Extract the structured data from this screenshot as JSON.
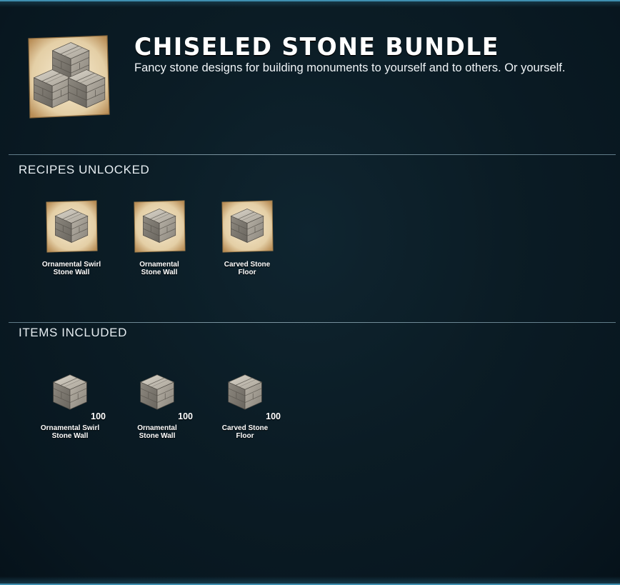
{
  "bundle": {
    "title": "Chiseled Stone Bundle",
    "description": "Fancy stone designs for building monuments to yourself and to others. Or yourself.",
    "icon": "stone-blocks-icon"
  },
  "recipes_section": {
    "heading": "RECIPES UNLOCKED",
    "items": [
      {
        "line1": "Ornamental Swirl",
        "line2": "Stone Wall",
        "icon": "ornamental-swirl-stone-wall-icon"
      },
      {
        "line1": "Ornamental",
        "line2": "Stone Wall",
        "icon": "ornamental-stone-wall-icon"
      },
      {
        "line1": "Carved Stone",
        "line2": "Floor",
        "icon": "carved-stone-floor-icon"
      }
    ]
  },
  "items_section": {
    "heading": "ITEMS INCLUDED",
    "items": [
      {
        "quantity": "100",
        "line1": "Ornamental Swirl",
        "line2": "Stone Wall",
        "icon": "ornamental-swirl-stone-wall-icon"
      },
      {
        "quantity": "100",
        "line1": "Ornamental",
        "line2": "Stone Wall",
        "icon": "ornamental-stone-wall-icon"
      },
      {
        "quantity": "100",
        "line1": "Carved Stone",
        "line2": "Floor",
        "icon": "carved-stone-floor-icon"
      }
    ]
  },
  "colors": {
    "background": "#0b1c25",
    "accent_border": "#3f8fb0",
    "parchment": "#e9d7b5",
    "stone": "#9a958c"
  }
}
